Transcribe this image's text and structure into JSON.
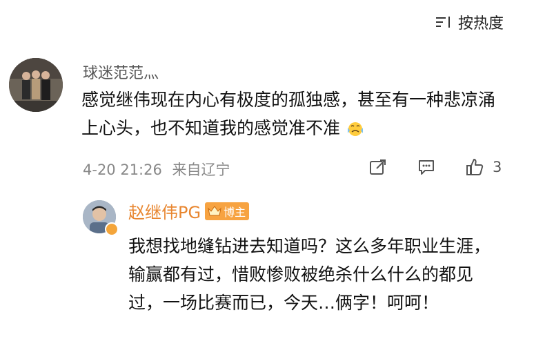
{
  "sort": {
    "label": "按热度",
    "icon": "sort-icon"
  },
  "comment": {
    "username": "球迷范范灬",
    "text": "感觉继伟现在内心有极度的孤独感，甚至有一种悲凉涌上心头，也不知道我的感觉准不准",
    "emoji": "crying-face-icon",
    "time": "4-20 21:26",
    "location": "来自辽宁",
    "likes": "3",
    "avatar_icon": "user-avatar"
  },
  "reply": {
    "username": "赵继伟PG",
    "badge": "博主",
    "text": "我想找地缝钻进去知道吗？这么多年职业生涯，输赢都有过，惜败惨败被绝杀什么什么的都见过，一场比赛而已，今天…俩字！呵呵！",
    "verified_icon": "verified-badge-icon"
  },
  "colors": {
    "accent": "#e8862f",
    "badge_bg": "#f7a341",
    "meta": "#888888"
  }
}
